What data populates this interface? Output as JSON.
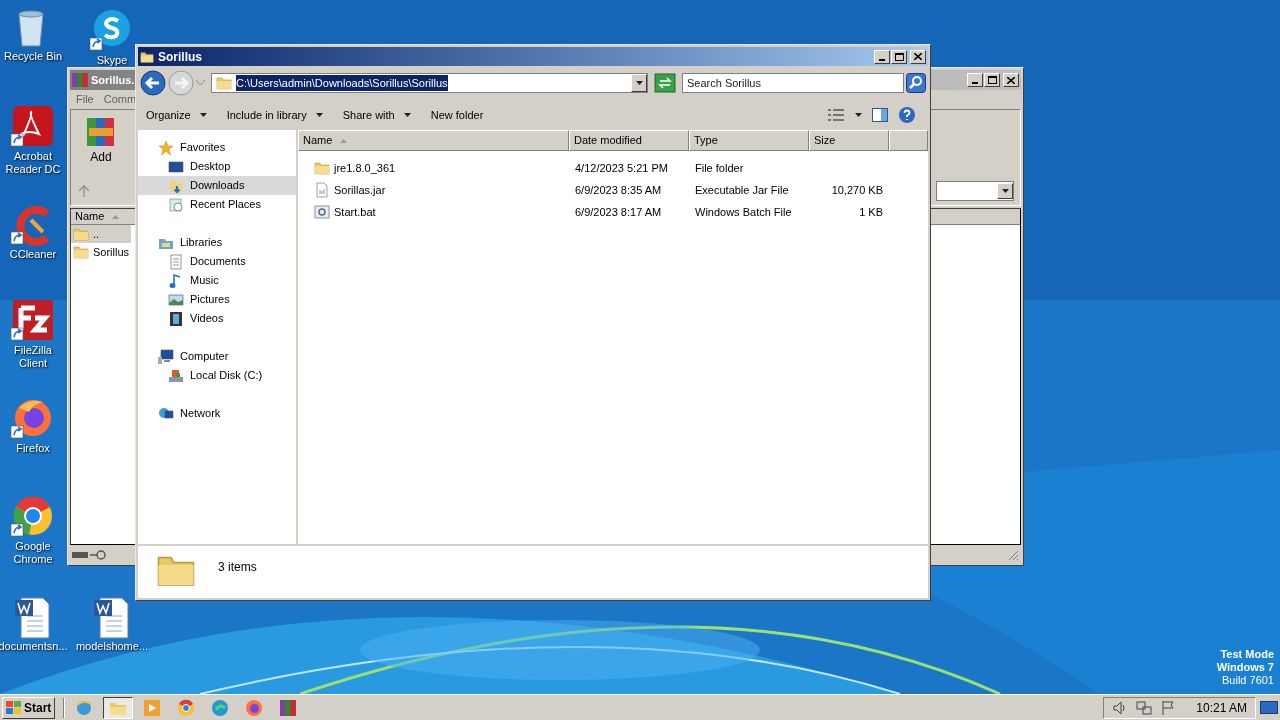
{
  "desktop_icons": [
    {
      "kind": "recycle-bin",
      "label": "Recycle Bin",
      "shortcut": false
    },
    {
      "kind": "skype",
      "label": "Skype",
      "shortcut": true
    },
    {
      "kind": "acrobat",
      "label": "Acrobat Reader DC",
      "shortcut": true
    },
    {
      "kind": "ccleaner",
      "label": "CCleaner",
      "shortcut": true
    },
    {
      "kind": "filezilla",
      "label": "FileZilla Client",
      "shortcut": true
    },
    {
      "kind": "firefox",
      "label": "Firefox",
      "shortcut": true
    },
    {
      "kind": "chrome",
      "label": "Google Chrome",
      "shortcut": true
    },
    {
      "kind": "word",
      "label": "documentsn...",
      "shortcut": false
    },
    {
      "kind": "word",
      "label": "modelshome...",
      "shortcut": false
    }
  ],
  "archive_window": {
    "title": "Sorillus.",
    "menu": [
      "File",
      "Comm"
    ],
    "toolbar_button": "Add",
    "column": "Name",
    "rows": [
      {
        "name": "..",
        "selected": true
      },
      {
        "name": "Sorillus",
        "selected": false
      }
    ]
  },
  "explorer": {
    "title": "Sorillus",
    "address": "C:\\Users\\admin\\Downloads\\Sorillus\\Sorillus",
    "address_selected": true,
    "search_placeholder": "Search Sorillus",
    "commands": [
      {
        "label": "Organize",
        "dropdown": true
      },
      {
        "label": "Include in library",
        "dropdown": true
      },
      {
        "label": "Share with",
        "dropdown": true
      },
      {
        "label": "New folder",
        "dropdown": false
      }
    ],
    "nav": [
      {
        "kind": "favorites",
        "label": "Favorites",
        "selected": false,
        "children": [
          {
            "kind": "desktop",
            "label": "Desktop",
            "selected": false
          },
          {
            "kind": "downloads",
            "label": "Downloads",
            "selected": true
          },
          {
            "kind": "recent",
            "label": "Recent Places",
            "selected": false
          }
        ]
      },
      {
        "kind": "libraries",
        "label": "Libraries",
        "selected": false,
        "children": [
          {
            "kind": "documents",
            "label": "Documents",
            "selected": false
          },
          {
            "kind": "music",
            "label": "Music",
            "selected": false
          },
          {
            "kind": "pictures",
            "label": "Pictures",
            "selected": false
          },
          {
            "kind": "videos",
            "label": "Videos",
            "selected": false
          }
        ]
      },
      {
        "kind": "computer",
        "label": "Computer",
        "selected": false,
        "children": [
          {
            "kind": "disk",
            "label": "Local Disk (C:)",
            "selected": false
          }
        ]
      },
      {
        "kind": "network",
        "label": "Network",
        "selected": false
      }
    ],
    "columns": [
      "Name",
      "Date modified",
      "Type",
      "Size"
    ],
    "files": [
      {
        "kind": "folder",
        "name": "jre1.8.0_361",
        "date": "4/12/2023 5:21 PM",
        "type": "File folder"
      },
      {
        "kind": "jar",
        "name": "Sorillas.jar",
        "date": "6/9/2023 8:35 AM",
        "type": "Executable Jar File",
        "size": "10,270 KB"
      },
      {
        "kind": "bat",
        "name": "Start.bat",
        "date": "6/9/2023 8:17 AM",
        "type": "Windows Batch File",
        "size": "1 KB"
      }
    ],
    "status": "3 items"
  },
  "taskbar": {
    "start": "Start",
    "apps": [
      {
        "kind": "ie",
        "active": false
      },
      {
        "kind": "explorer",
        "active": true
      },
      {
        "kind": "media",
        "active": false
      },
      {
        "kind": "chrome",
        "active": false
      },
      {
        "kind": "edge",
        "active": false
      },
      {
        "kind": "firefox",
        "active": false
      },
      {
        "kind": "winrar",
        "active": false
      }
    ],
    "clock": "10:21 AM"
  },
  "system_notice": [
    "Test Mode",
    "Windows 7",
    "Build 7601"
  ]
}
